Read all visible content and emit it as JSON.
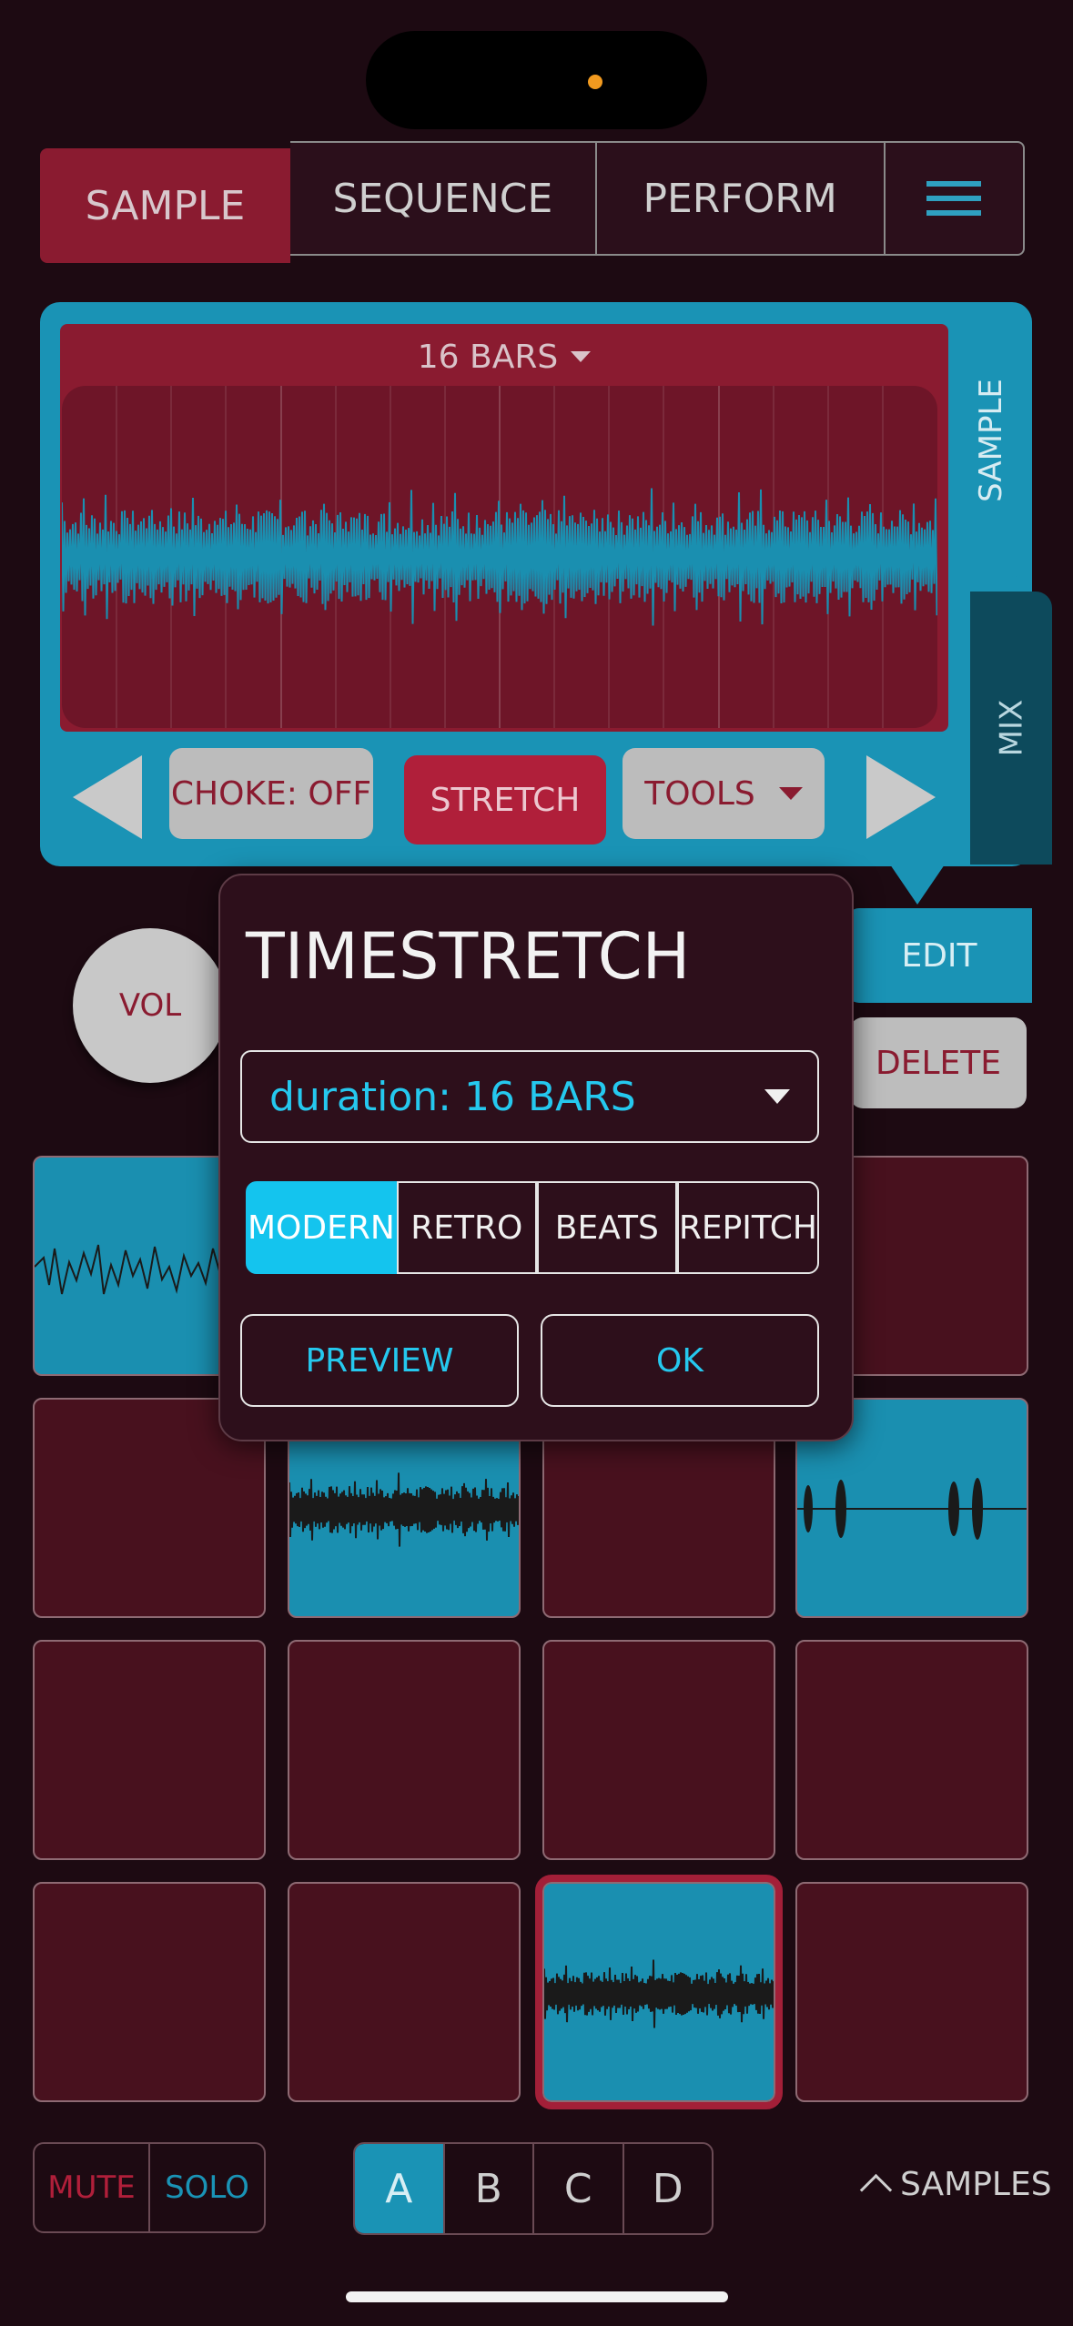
{
  "header": {
    "tabs": [
      {
        "label": "SAMPLE",
        "active": true
      },
      {
        "label": "SEQUENCE",
        "active": false
      },
      {
        "label": "PERFORM",
        "active": false
      }
    ],
    "menu_icon": "hamburger-icon"
  },
  "sample_panel": {
    "bars_label": "16 BARS",
    "side_tabs": {
      "sample": "SAMPLE",
      "mix": "MIX"
    },
    "choke_label": "CHOKE: OFF",
    "stretch_label": "STRETCH",
    "tools_label": "TOOLS",
    "prev_icon": "triangle-left-icon",
    "next_icon": "triangle-right-icon"
  },
  "controls": {
    "vol_label": "VOL",
    "edit_label": "EDIT",
    "delete_label": "DELETE"
  },
  "dialog": {
    "title": "TIMESTRETCH",
    "duration_value": "duration: 16 BARS",
    "modes": [
      {
        "label": "MODERN",
        "active": true
      },
      {
        "label": "RETRO",
        "active": false
      },
      {
        "label": "BEATS",
        "active": false
      },
      {
        "label": "REPITCH",
        "active": false
      }
    ],
    "preview_label": "PREVIEW",
    "ok_label": "OK"
  },
  "footer": {
    "mute_label": "MUTE",
    "solo_label": "SOLO",
    "banks": [
      {
        "label": "A",
        "active": true
      },
      {
        "label": "B",
        "active": false
      },
      {
        "label": "C",
        "active": false
      },
      {
        "label": "D",
        "active": false
      }
    ],
    "samples_label": "SAMPLES"
  },
  "colors": {
    "background": "#1d0a12",
    "accent_red": "#8a1b30",
    "accent_blue": "#1a93b5",
    "active_cyan": "#14c4ee"
  }
}
